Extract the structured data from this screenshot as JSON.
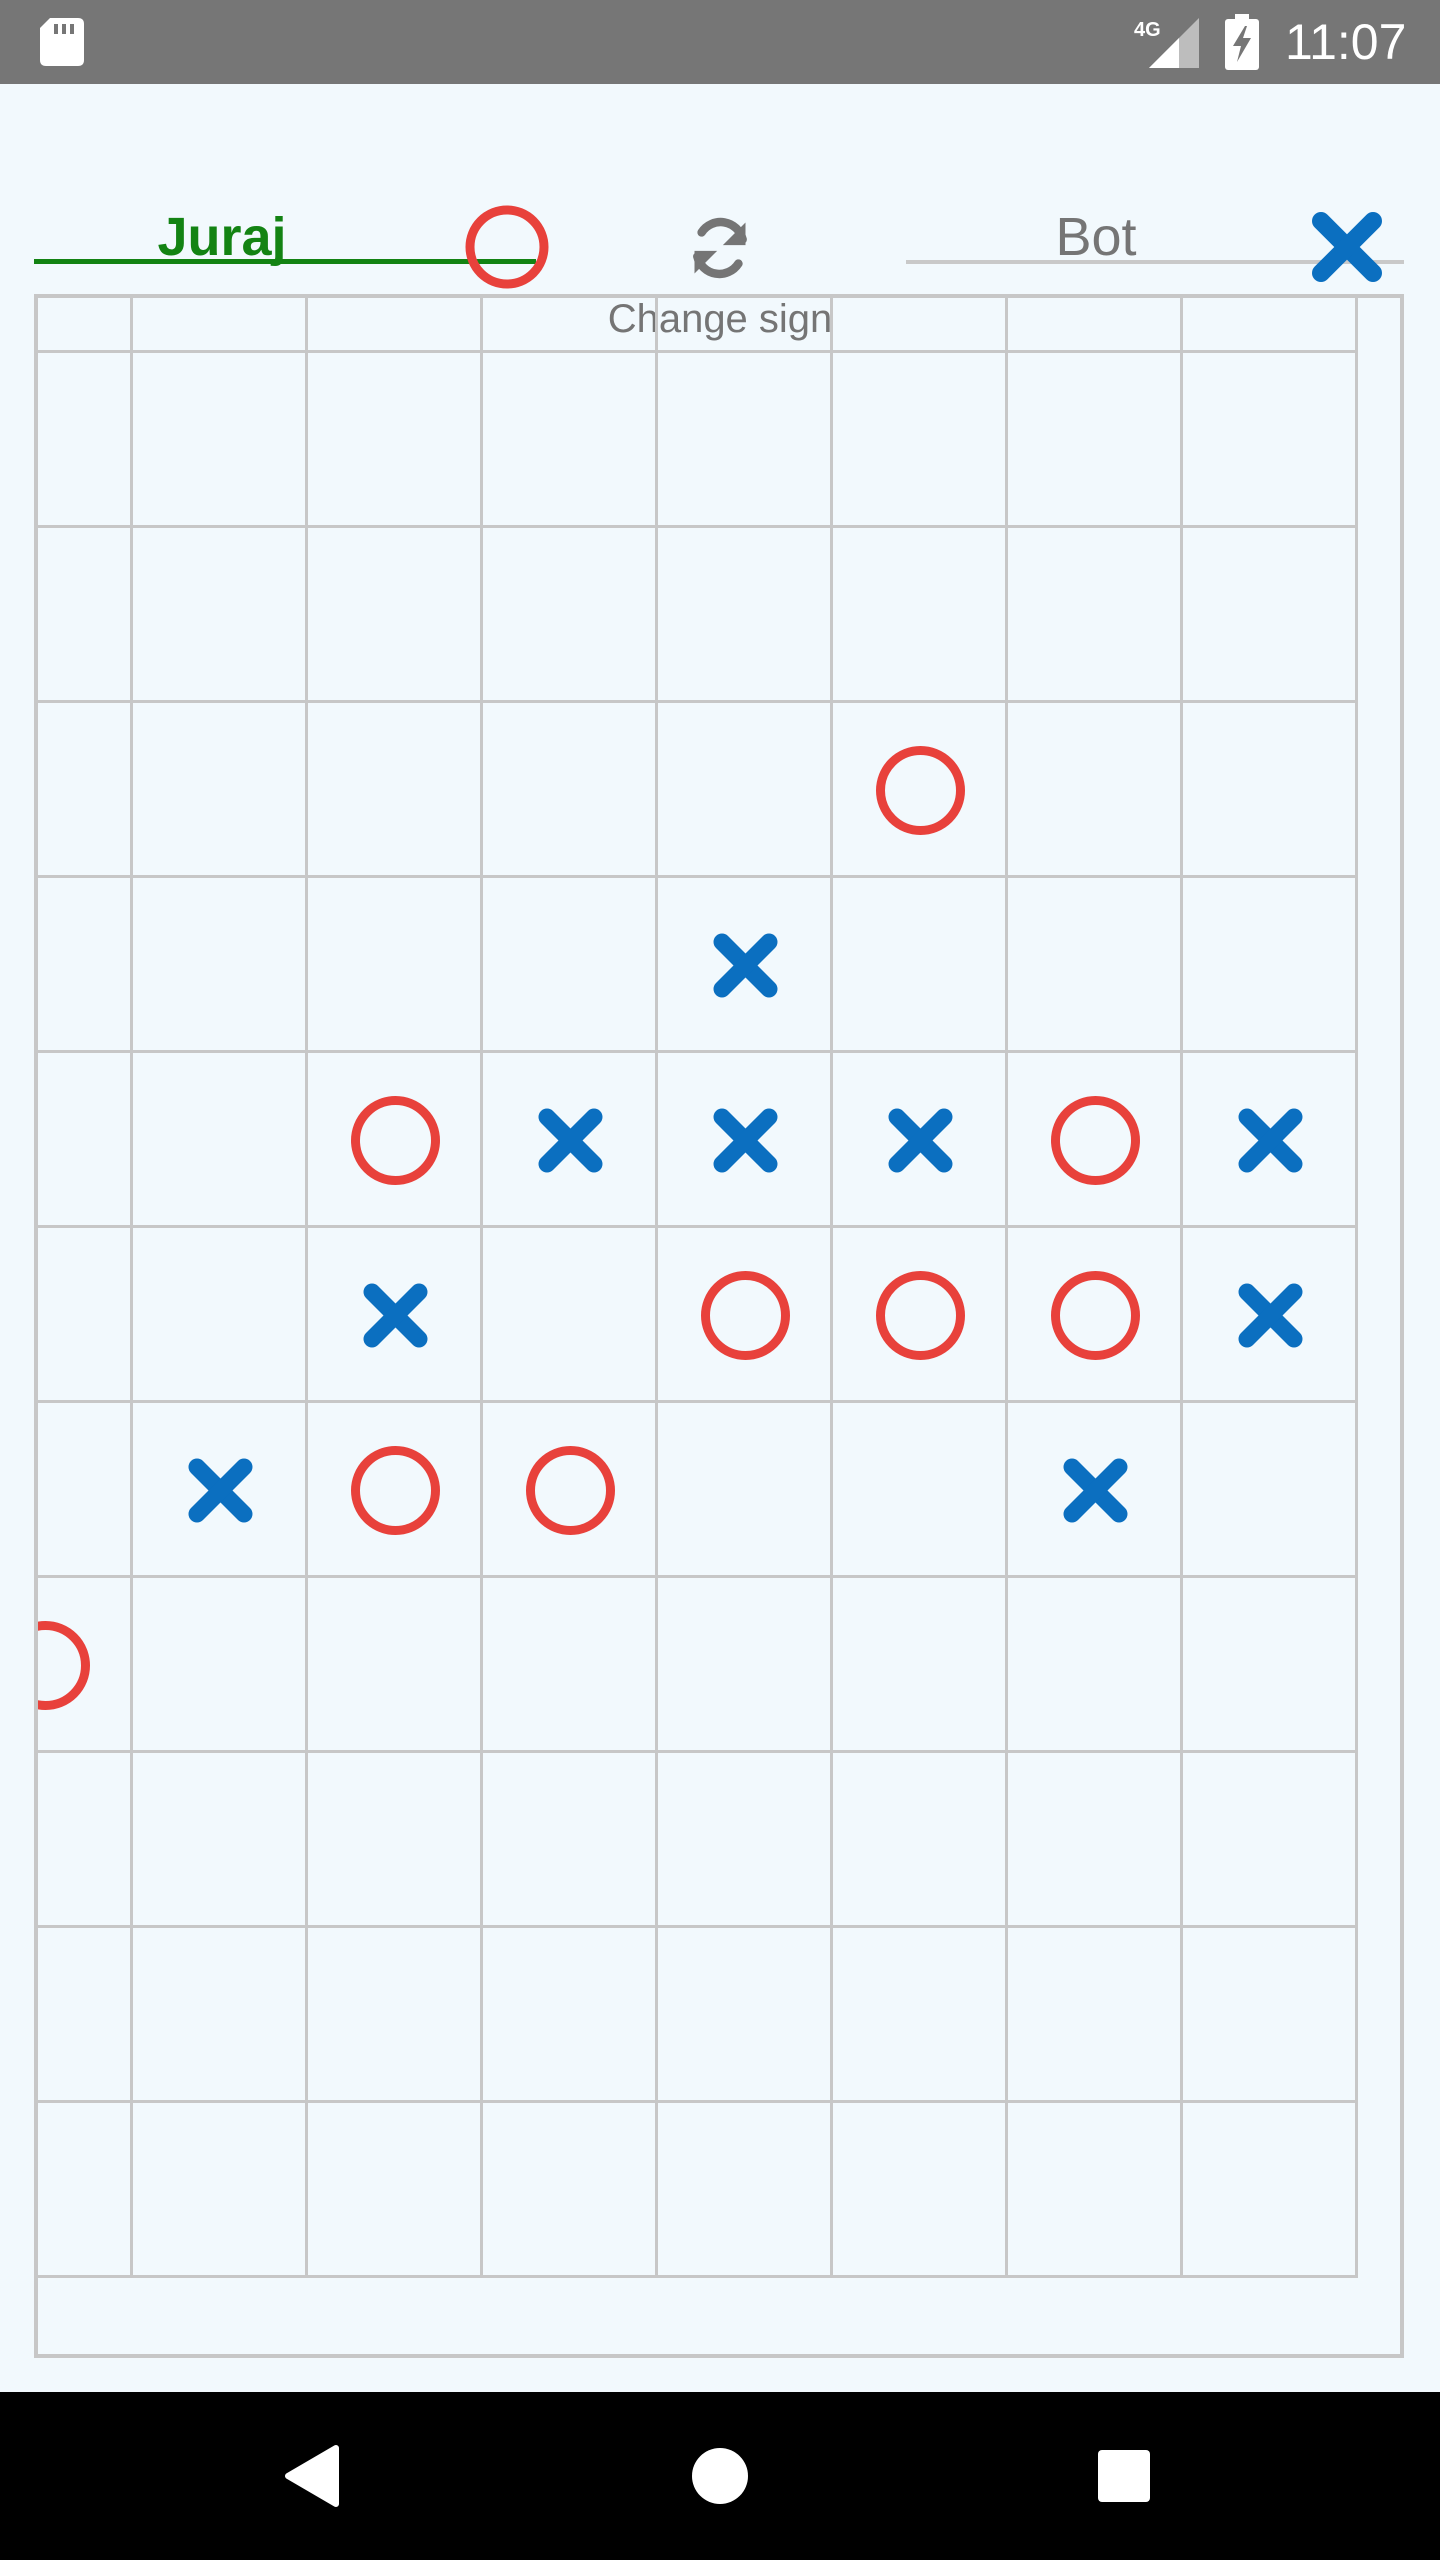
{
  "status_bar": {
    "time": "11:07",
    "network": "4G",
    "icons": [
      "sd-card-icon",
      "signal-icon",
      "battery-charging-icon"
    ]
  },
  "header": {
    "player": {
      "name": "Juraj",
      "sign": "O",
      "sign_icon": "circle-icon"
    },
    "change_sign": {
      "label": "Change sign",
      "icon": "refresh-icon"
    },
    "bot": {
      "name": "Bot",
      "sign": "X",
      "sign_icon": "cross-icon"
    }
  },
  "colors": {
    "player_active": "#138313",
    "o_mark": "#e8413b",
    "x_mark": "#0b6fc0",
    "grid_line": "#c7c7c7",
    "background": "#f2f9fd"
  },
  "board": {
    "grid_columns": 8,
    "grid_rows": 12,
    "marks": [
      {
        "row": 3,
        "col": 5,
        "sign": "O"
      },
      {
        "row": 4,
        "col": 4,
        "sign": "X"
      },
      {
        "row": 5,
        "col": 2,
        "sign": "O"
      },
      {
        "row": 5,
        "col": 3,
        "sign": "X"
      },
      {
        "row": 5,
        "col": 4,
        "sign": "X"
      },
      {
        "row": 5,
        "col": 5,
        "sign": "X"
      },
      {
        "row": 5,
        "col": 6,
        "sign": "O"
      },
      {
        "row": 5,
        "col": 7,
        "sign": "X"
      },
      {
        "row": 6,
        "col": 2,
        "sign": "X"
      },
      {
        "row": 6,
        "col": 4,
        "sign": "O"
      },
      {
        "row": 6,
        "col": 5,
        "sign": "O"
      },
      {
        "row": 6,
        "col": 6,
        "sign": "O"
      },
      {
        "row": 6,
        "col": 7,
        "sign": "X"
      },
      {
        "row": 7,
        "col": 1,
        "sign": "X"
      },
      {
        "row": 7,
        "col": 2,
        "sign": "O"
      },
      {
        "row": 7,
        "col": 3,
        "sign": "O"
      },
      {
        "row": 7,
        "col": 6,
        "sign": "X"
      },
      {
        "row": 8,
        "col": 0,
        "sign": "O"
      }
    ]
  },
  "nav_bar": {
    "buttons": [
      "back-icon",
      "home-icon",
      "recents-icon"
    ]
  }
}
